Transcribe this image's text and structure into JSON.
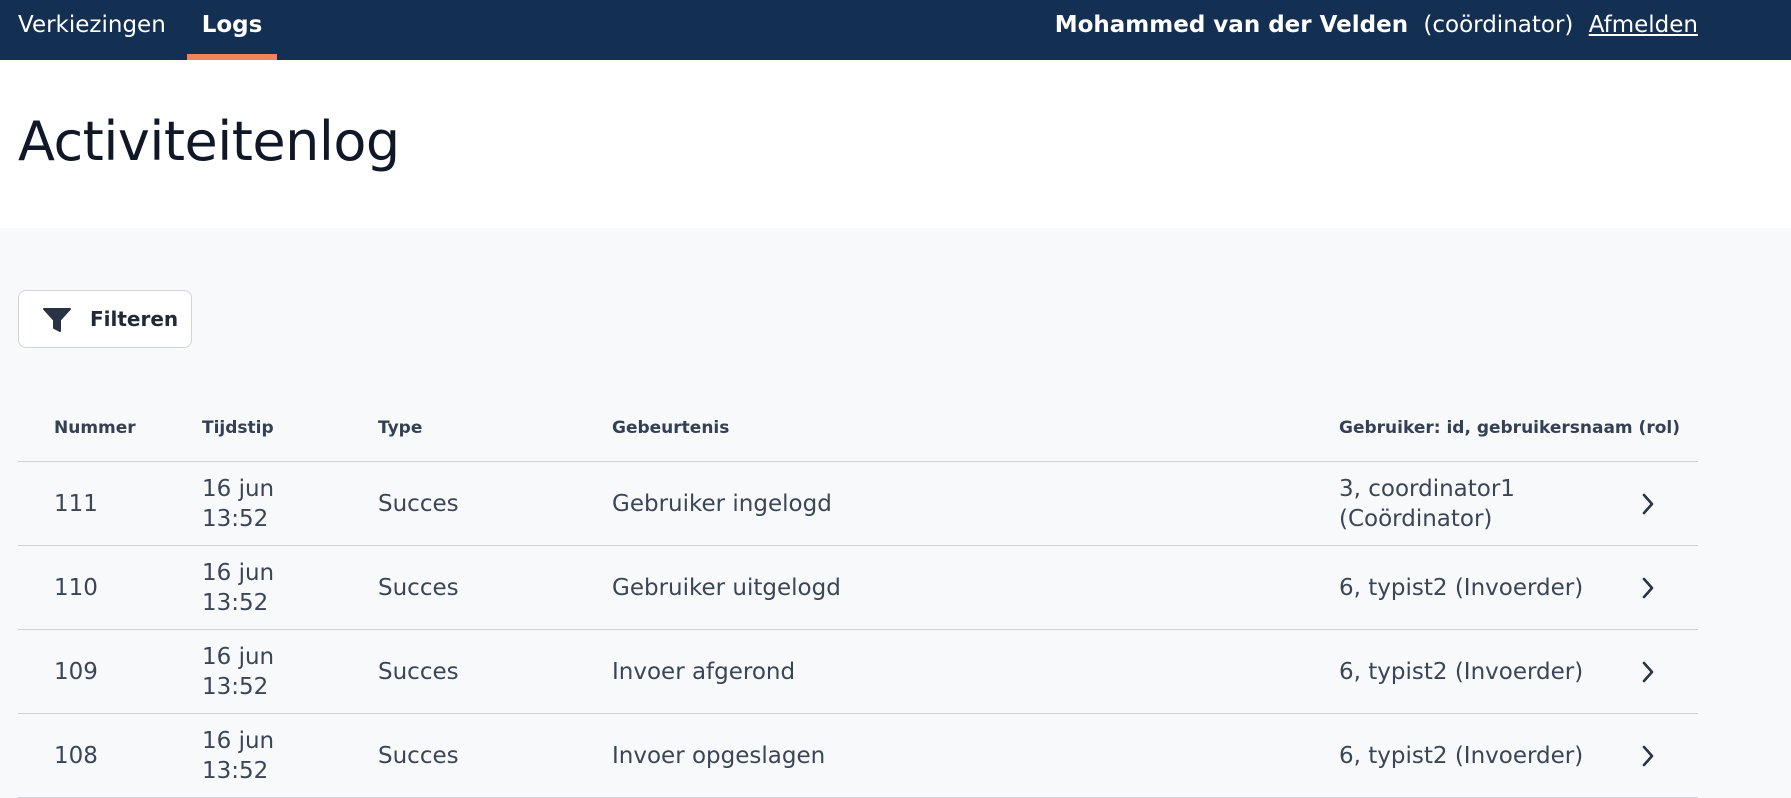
{
  "nav": {
    "elections_label": "Verkiezingen",
    "logs_label": "Logs",
    "user_name": "Mohammed van der Velden",
    "user_role": "(coördinator)",
    "logout_label": "Afmelden"
  },
  "page": {
    "title": "Activiteitenlog",
    "filter_label": "Filteren"
  },
  "table": {
    "headers": {
      "number": "Nummer",
      "time": "Tijdstip",
      "type": "Type",
      "event": "Gebeurtenis",
      "user": "Gebruiker: id, gebruikersnaam (rol)"
    },
    "rows": [
      {
        "number": "111",
        "date": "16 jun",
        "time": "13:52",
        "type": "Succes",
        "event": "Gebruiker ingelogd",
        "user_line1": "3, coordinator1",
        "user_line2": "(Coördinator)"
      },
      {
        "number": "110",
        "date": "16 jun",
        "time": "13:52",
        "type": "Succes",
        "event": "Gebruiker uitgelogd",
        "user_line1": "6, typist2 (Invoerder)",
        "user_line2": ""
      },
      {
        "number": "109",
        "date": "16 jun",
        "time": "13:52",
        "type": "Succes",
        "event": "Invoer afgerond",
        "user_line1": "6, typist2 (Invoerder)",
        "user_line2": ""
      },
      {
        "number": "108",
        "date": "16 jun",
        "time": "13:52",
        "type": "Succes",
        "event": "Invoer opgeslagen",
        "user_line1": "6, typist2 (Invoerder)",
        "user_line2": ""
      }
    ]
  },
  "colors": {
    "nav_background": "#132f52",
    "active_accent": "#f0845c",
    "page_background": "#f8f9fb"
  },
  "icons": {
    "filter": "funnel-icon",
    "row_action": "chevron-right-icon"
  }
}
